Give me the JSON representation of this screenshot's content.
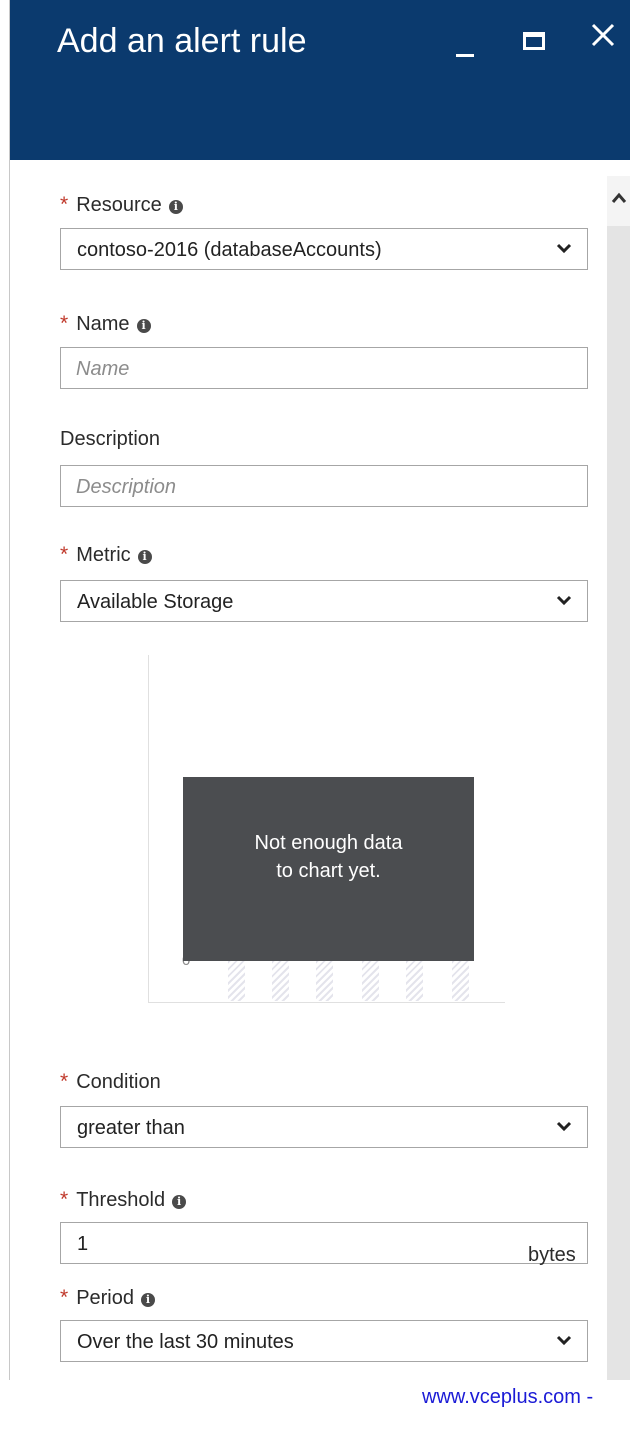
{
  "blade": {
    "title": "Add an alert rule"
  },
  "form": {
    "resource": {
      "label": "Resource",
      "required_mark": "*",
      "info": "i",
      "value": "contoso-2016 (databaseAccounts)"
    },
    "name": {
      "label": "Name",
      "required_mark": "*",
      "info": "i",
      "placeholder": "Name"
    },
    "description": {
      "label": "Description",
      "placeholder": "Description"
    },
    "metric": {
      "label": "Metric",
      "required_mark": "*",
      "info": "i",
      "value": "Available Storage"
    },
    "chart": {
      "zero_label": "0",
      "message_line1": "Not enough data",
      "message_line2": "to chart yet."
    },
    "condition": {
      "label": "Condition",
      "required_mark": "*",
      "value": "greater than"
    },
    "threshold": {
      "label": "Threshold",
      "required_mark": "*",
      "info": "i",
      "value": "1",
      "unit": "bytes"
    },
    "period": {
      "label": "Period",
      "required_mark": "*",
      "info": "i",
      "value": "Over the last 30 minutes"
    }
  },
  "watermark": "www.vceplus.com -",
  "colors": {
    "header": "#0b3a6e",
    "required": "#c0392b",
    "chart_overlay": "#4b4d50",
    "watermark": "#1b1bd6"
  },
  "icons": {
    "minimize": "minimize-icon",
    "maximize": "maximize-icon",
    "close": "close-icon",
    "dropdown": "chevron-down-icon",
    "info": "info-icon",
    "scroll_up": "chevron-up-icon"
  }
}
